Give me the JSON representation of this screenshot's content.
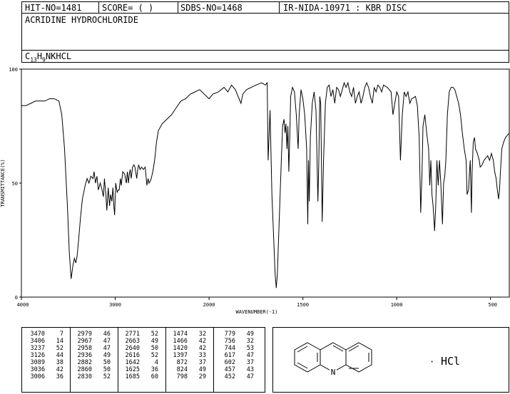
{
  "header": {
    "hit_no": "HIT-NO=1481",
    "score": "SCORE=  (   )",
    "sdbs_no": "SDBS-NO=1468",
    "method": "IR-NIDA-10971 : KBR DISC",
    "compound": "ACRIDINE HYDROCHLORIDE",
    "formula_c": "C",
    "formula_c_sub": "13",
    "formula_h": "H",
    "formula_h_sub": "9",
    "formula_rest": "NKHCL"
  },
  "chart_data": {
    "type": "line",
    "title": "",
    "xlabel": "WAVENUMBER(-1)",
    "ylabel": "TRANSMITTANCE(%)",
    "xlim": [
      4000,
      400
    ],
    "ylim": [
      0,
      100
    ],
    "x_ticks": [
      4000,
      3000,
      2000,
      1500,
      1000,
      500
    ],
    "y_ticks": [
      0,
      50,
      100
    ],
    "grid": false,
    "series": [
      {
        "name": "",
        "points": [
          [
            4000,
            84
          ],
          [
            3950,
            84
          ],
          [
            3900,
            85
          ],
          [
            3850,
            86
          ],
          [
            3800,
            86
          ],
          [
            3750,
            86
          ],
          [
            3700,
            87
          ],
          [
            3650,
            87
          ],
          [
            3600,
            86
          ],
          [
            3570,
            80
          ],
          [
            3540,
            65
          ],
          [
            3510,
            40
          ],
          [
            3490,
            20
          ],
          [
            3470,
            8
          ],
          [
            3450,
            14
          ],
          [
            3435,
            17
          ],
          [
            3420,
            15
          ],
          [
            3406,
            18
          ],
          [
            3390,
            25
          ],
          [
            3370,
            35
          ],
          [
            3350,
            43
          ],
          [
            3320,
            49
          ],
          [
            3300,
            52
          ],
          [
            3280,
            50
          ],
          [
            3260,
            53
          ],
          [
            3237,
            52
          ],
          [
            3225,
            55
          ],
          [
            3210,
            50
          ],
          [
            3195,
            53
          ],
          [
            3180,
            47
          ],
          [
            3160,
            50
          ],
          [
            3140,
            47
          ],
          [
            3126,
            44
          ],
          [
            3115,
            52
          ],
          [
            3100,
            45
          ],
          [
            3089,
            38
          ],
          [
            3075,
            48
          ],
          [
            3060,
            40
          ],
          [
            3050,
            45
          ],
          [
            3036,
            42
          ],
          [
            3025,
            48
          ],
          [
            3015,
            40
          ],
          [
            3006,
            36
          ],
          [
            2995,
            50
          ],
          [
            2979,
            46
          ],
          [
            2967,
            47
          ],
          [
            2958,
            47
          ],
          [
            2945,
            52
          ],
          [
            2936,
            49
          ],
          [
            2920,
            55
          ],
          [
            2900,
            54
          ],
          [
            2882,
            50
          ],
          [
            2870,
            55
          ],
          [
            2860,
            50
          ],
          [
            2850,
            54
          ],
          [
            2840,
            56
          ],
          [
            2830,
            52
          ],
          [
            2815,
            57
          ],
          [
            2800,
            58
          ],
          [
            2790,
            57
          ],
          [
            2771,
            52
          ],
          [
            2760,
            56
          ],
          [
            2750,
            58
          ],
          [
            2735,
            56
          ],
          [
            2720,
            57
          ],
          [
            2700,
            56
          ],
          [
            2680,
            57
          ],
          [
            2663,
            49
          ],
          [
            2650,
            52
          ],
          [
            2640,
            50
          ],
          [
            2625,
            51
          ],
          [
            2616,
            52
          ],
          [
            2600,
            55
          ],
          [
            2580,
            60
          ],
          [
            2560,
            68
          ],
          [
            2540,
            73
          ],
          [
            2500,
            76
          ],
          [
            2450,
            78
          ],
          [
            2400,
            80
          ],
          [
            2350,
            83
          ],
          [
            2300,
            86
          ],
          [
            2250,
            87
          ],
          [
            2200,
            89
          ],
          [
            2150,
            90
          ],
          [
            2100,
            91
          ],
          [
            2050,
            89
          ],
          [
            2000,
            87
          ],
          [
            1980,
            89
          ],
          [
            1950,
            90
          ],
          [
            1920,
            92
          ],
          [
            1900,
            90
          ],
          [
            1880,
            93
          ],
          [
            1860,
            91
          ],
          [
            1830,
            85
          ],
          [
            1820,
            89
          ],
          [
            1800,
            91
          ],
          [
            1750,
            93
          ],
          [
            1720,
            94
          ],
          [
            1700,
            93
          ],
          [
            1690,
            94
          ],
          [
            1685,
            60
          ],
          [
            1675,
            82
          ],
          [
            1665,
            45
          ],
          [
            1655,
            25
          ],
          [
            1648,
            10
          ],
          [
            1642,
            4
          ],
          [
            1636,
            10
          ],
          [
            1625,
            36
          ],
          [
            1615,
            60
          ],
          [
            1608,
            75
          ],
          [
            1600,
            78
          ],
          [
            1595,
            72
          ],
          [
            1590,
            76
          ],
          [
            1585,
            65
          ],
          [
            1580,
            75
          ],
          [
            1575,
            55
          ],
          [
            1570,
            70
          ],
          [
            1565,
            88
          ],
          [
            1555,
            92
          ],
          [
            1545,
            90
          ],
          [
            1535,
            80
          ],
          [
            1525,
            65
          ],
          [
            1520,
            80
          ],
          [
            1510,
            91
          ],
          [
            1500,
            87
          ],
          [
            1490,
            80
          ],
          [
            1480,
            65
          ],
          [
            1474,
            32
          ],
          [
            1470,
            60
          ],
          [
            1466,
            42
          ],
          [
            1460,
            70
          ],
          [
            1450,
            85
          ],
          [
            1440,
            90
          ],
          [
            1430,
            82
          ],
          [
            1420,
            42
          ],
          [
            1415,
            60
          ],
          [
            1410,
            88
          ],
          [
            1405,
            85
          ],
          [
            1397,
            33
          ],
          [
            1390,
            60
          ],
          [
            1380,
            85
          ],
          [
            1370,
            92
          ],
          [
            1360,
            93
          ],
          [
            1350,
            88
          ],
          [
            1340,
            91
          ],
          [
            1330,
            85
          ],
          [
            1320,
            92
          ],
          [
            1310,
            91
          ],
          [
            1300,
            88
          ],
          [
            1280,
            94
          ],
          [
            1270,
            92
          ],
          [
            1260,
            94
          ],
          [
            1250,
            90
          ],
          [
            1240,
            88
          ],
          [
            1230,
            92
          ],
          [
            1220,
            85
          ],
          [
            1210,
            88
          ],
          [
            1200,
            90
          ],
          [
            1190,
            85
          ],
          [
            1180,
            88
          ],
          [
            1170,
            92
          ],
          [
            1160,
            94
          ],
          [
            1150,
            92
          ],
          [
            1140,
            88
          ],
          [
            1130,
            85
          ],
          [
            1120,
            92
          ],
          [
            1110,
            90
          ],
          [
            1100,
            93
          ],
          [
            1090,
            92
          ],
          [
            1080,
            90
          ],
          [
            1070,
            93
          ],
          [
            1050,
            92
          ],
          [
            1030,
            90
          ],
          [
            1020,
            80
          ],
          [
            1010,
            85
          ],
          [
            1000,
            90
          ],
          [
            990,
            88
          ],
          [
            980,
            60
          ],
          [
            970,
            80
          ],
          [
            960,
            90
          ],
          [
            950,
            88
          ],
          [
            940,
            90
          ],
          [
            930,
            85
          ],
          [
            920,
            87
          ],
          [
            900,
            88
          ],
          [
            890,
            84
          ],
          [
            880,
            70
          ],
          [
            872,
            37
          ],
          [
            865,
            55
          ],
          [
            860,
            75
          ],
          [
            850,
            80
          ],
          [
            840,
            72
          ],
          [
            830,
            65
          ],
          [
            824,
            49
          ],
          [
            818,
            60
          ],
          [
            812,
            45
          ],
          [
            806,
            40
          ],
          [
            798,
            29
          ],
          [
            792,
            40
          ],
          [
            786,
            60
          ],
          [
            779,
            49
          ],
          [
            772,
            60
          ],
          [
            765,
            50
          ],
          [
            756,
            32
          ],
          [
            750,
            50
          ],
          [
            744,
            53
          ],
          [
            738,
            60
          ],
          [
            730,
            80
          ],
          [
            720,
            90
          ],
          [
            710,
            92
          ],
          [
            700,
            92
          ],
          [
            690,
            91
          ],
          [
            680,
            88
          ],
          [
            670,
            85
          ],
          [
            660,
            80
          ],
          [
            650,
            72
          ],
          [
            640,
            65
          ],
          [
            630,
            60
          ],
          [
            625,
            45
          ],
          [
            617,
            47
          ],
          [
            612,
            55
          ],
          [
            608,
            60
          ],
          [
            602,
            37
          ],
          [
            598,
            55
          ],
          [
            592,
            68
          ],
          [
            585,
            70
          ],
          [
            580,
            65
          ],
          [
            570,
            63
          ],
          [
            560,
            60
          ],
          [
            555,
            57
          ],
          [
            545,
            58
          ],
          [
            535,
            60
          ],
          [
            525,
            61
          ],
          [
            515,
            62
          ],
          [
            505,
            60
          ],
          [
            495,
            63
          ],
          [
            485,
            60
          ],
          [
            478,
            55
          ],
          [
            470,
            52
          ],
          [
            465,
            48
          ],
          [
            457,
            43
          ],
          [
            452,
            47
          ],
          [
            447,
            55
          ],
          [
            440,
            65
          ],
          [
            430,
            68
          ],
          [
            420,
            70
          ],
          [
            410,
            71
          ],
          [
            400,
            72
          ]
        ]
      }
    ]
  },
  "peak_table": {
    "columns": [
      [
        [
          "3470",
          "7"
        ],
        [
          "3406",
          "14"
        ],
        [
          "3237",
          "52"
        ],
        [
          "3126",
          "44"
        ],
        [
          "3089",
          "38"
        ],
        [
          "3036",
          "42"
        ],
        [
          "3006",
          "36"
        ]
      ],
      [
        [
          "2979",
          "46"
        ],
        [
          "2967",
          "47"
        ],
        [
          "2958",
          "47"
        ],
        [
          "2936",
          "49"
        ],
        [
          "2882",
          "50"
        ],
        [
          "2860",
          "50"
        ],
        [
          "2830",
          "52"
        ]
      ],
      [
        [
          "2771",
          "52"
        ],
        [
          "2663",
          "49"
        ],
        [
          "2640",
          "50"
        ],
        [
          "2616",
          "52"
        ],
        [
          "1642",
          "4"
        ],
        [
          "1625",
          "36"
        ],
        [
          "1685",
          "60"
        ]
      ],
      [
        [
          "1474",
          "32"
        ],
        [
          "1466",
          "42"
        ],
        [
          "1420",
          "42"
        ],
        [
          "1397",
          "33"
        ],
        [
          "872",
          "37"
        ],
        [
          "824",
          "49"
        ],
        [
          "798",
          "29"
        ]
      ],
      [
        [
          "779",
          "49"
        ],
        [
          "756",
          "32"
        ],
        [
          "744",
          "53"
        ],
        [
          "617",
          "47"
        ],
        [
          "602",
          "37"
        ],
        [
          "457",
          "43"
        ],
        [
          "452",
          "47"
        ]
      ]
    ]
  },
  "structure": {
    "atom_n": "N",
    "salt_label": "HCl",
    "dot": "·"
  }
}
